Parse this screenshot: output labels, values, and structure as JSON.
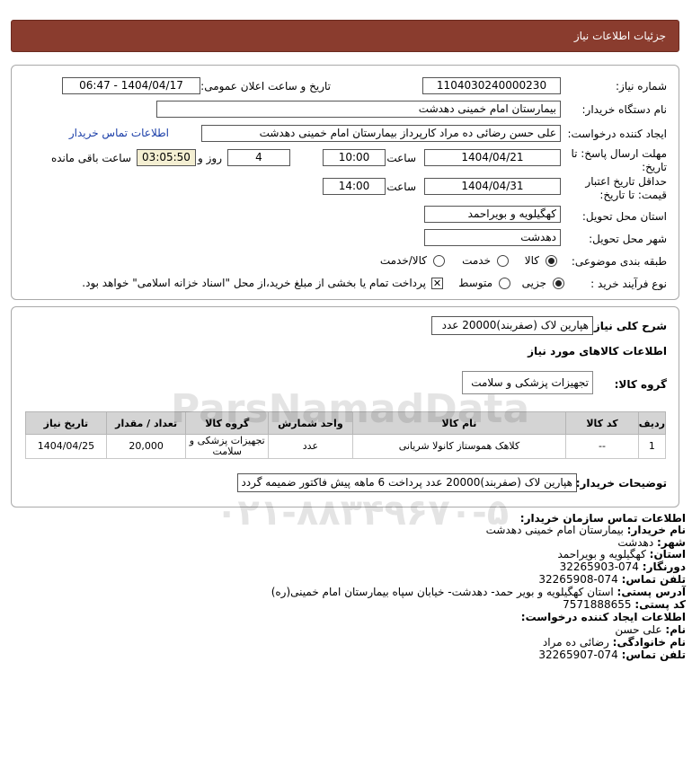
{
  "header": {
    "title": "جزئیات اطلاعات نیاز"
  },
  "form": {
    "need_number": {
      "label": "شماره نیاز:",
      "value": "1104030240000230"
    },
    "announce": {
      "label": "تاریخ و ساعت اعلان عمومی:",
      "value": "1404/04/17 - 06:47"
    },
    "buyer_org": {
      "label": "نام دستگاه خریدار:",
      "value": "بیمارستان امام خمینی دهدشت"
    },
    "requester": {
      "label": "ایجاد کننده درخواست:",
      "value": "علی حسن رضائی ده مراد کارپرداز بیمارستان امام خمینی دهدشت"
    },
    "contact_link": "اطلاعات تماس خریدار",
    "deadline": {
      "label_line1": "مهلت ارسال پاسخ: تا",
      "label_line2": "تاریخ:",
      "date": "1404/04/21",
      "time_label": "ساعت",
      "time": "10:00",
      "days": "4",
      "days_label": "روز و",
      "remaining": "03:05:50",
      "remaining_label": "ساعت باقی مانده"
    },
    "validity": {
      "label_line1": "حداقل تاریخ اعتبار",
      "label_line2": "قیمت: تا تاریخ:",
      "date": "1404/04/31",
      "time_label": "ساعت",
      "time": "14:00"
    },
    "province": {
      "label": "استان محل تحویل:",
      "value": "کهگیلویه و بویراحمد"
    },
    "city": {
      "label": "شهر محل تحویل:",
      "value": "دهدشت"
    },
    "category": {
      "label": "طبقه بندی موضوعی:",
      "options": [
        "کالا",
        "خدمت",
        "کالا/خدمت"
      ],
      "selected": "کالا"
    },
    "purchase_type": {
      "label": "نوع فرآیند خرید :",
      "options": [
        "جزیی",
        "متوسط"
      ],
      "selected": "جزیی",
      "note": "پرداخت تمام یا بخشی از مبلغ خرید،از محل \"اسناد خزانه اسلامی\" خواهد بود."
    }
  },
  "details": {
    "summary_label": "شرح کلی نیاز:",
    "summary": "هپارین لاک (صفربند)20000 عدد",
    "goods_title": "اطلاعات کالاهای مورد نیاز",
    "group_label": "گروه کالا:",
    "group": "تجهیزات پزشکی و سلامت",
    "table": {
      "headers": [
        "ردیف",
        "کد کالا",
        "نام کالا",
        "واحد شمارش",
        "گروه کالا",
        "تعداد / مقدار",
        "تاریخ نیاز"
      ],
      "rows": [
        [
          "1",
          "--",
          "کلاهک هموستاز کانولا شریانی",
          "عدد",
          "تجهیزات پزشکی و سلامت",
          "20,000",
          "1404/04/25"
        ]
      ]
    },
    "buyer_notes_label": "توضیحات خریدار:",
    "buyer_notes": "هپارین لاک (صفربند)20000 عدد پرداخت 6 ماهه پیش فاکتور ضمیمه گردد"
  },
  "contact": {
    "org_title": "اطلاعات تماس سازمان خریدار:",
    "buyer_name_label": "نام خریدار:",
    "buyer_name": "بیمارستان امام خمینی دهدشت",
    "city_label": "شهر:",
    "city": "دهدشت",
    "province_label": "استان:",
    "province": "کهگیلویه و بویراحمد",
    "fax_label": "دورنگار:",
    "fax": "074-32265903",
    "phone_label": "تلفن تماس:",
    "phone": "074-32265908",
    "address_label": "آدرس پستی:",
    "address": "استان کهگیلویه و بویر حمد- دهدشت- خیابان سپاه بیمارستان امام خمینی(ره)",
    "postal_label": "کد پستی:",
    "postal": "7571888655",
    "creator_title": "اطلاعات ایجاد کننده درخواست:",
    "first_name_label": "نام:",
    "first_name": "علی حسن",
    "last_name_label": "نام خانوادگی:",
    "last_name": "رضائی ده مراد",
    "creator_phone_label": "تلفن تماس:",
    "creator_phone": "074-32265907"
  },
  "watermark": {
    "brand": "ParsNamadData",
    "phone": "۰۲۱-۸۸۳۴۹۶۷۰-۵"
  }
}
